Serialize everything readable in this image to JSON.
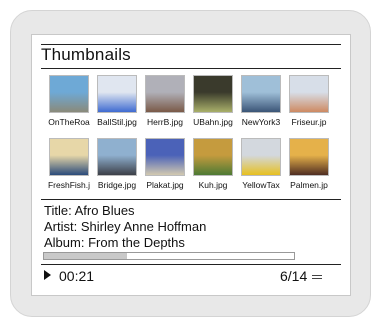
{
  "header": {
    "title": "Thumbnails"
  },
  "thumbnails": [
    {
      "label": "OnTheRoa",
      "icon": "road-photo",
      "color1": "#6ea9d6",
      "color2": "#8a8a7a"
    },
    {
      "label": "BallStil.jpg",
      "icon": "balls-photo",
      "color1": "#e0e6f0",
      "color2": "#3f6bd1"
    },
    {
      "label": "HerrB.jpg",
      "icon": "portrait-photo",
      "color1": "#b0b0b8",
      "color2": "#7a5a48"
    },
    {
      "label": "UBahn.jpg",
      "icon": "subway-photo",
      "color1": "#3a3a2c",
      "color2": "#a9b06a"
    },
    {
      "label": "NewYork3",
      "icon": "skyscraper-photo",
      "color1": "#9fbfd8",
      "color2": "#3b5577"
    },
    {
      "label": "Friseur.jp",
      "icon": "barber-photo",
      "color1": "#d7dee8",
      "color2": "#ce8a62"
    },
    {
      "label": "FreshFish.j",
      "icon": "fisherman-photo",
      "color1": "#e7d7a8",
      "color2": "#2a4a7a"
    },
    {
      "label": "Bridge.jpg",
      "icon": "bridge-photo",
      "color1": "#8fb0cf",
      "color2": "#3c3f47"
    },
    {
      "label": "Plakat.jpg",
      "icon": "poster-photo",
      "color1": "#4b62b8",
      "color2": "#d2c9b0"
    },
    {
      "label": "Kuh.jpg",
      "icon": "cow-photo",
      "color1": "#c59b3e",
      "color2": "#4d7a34"
    },
    {
      "label": "YellowTax",
      "icon": "taxi-photo",
      "color1": "#d3d8de",
      "color2": "#e6c020"
    },
    {
      "label": "Palmen.jp",
      "icon": "palms-photo",
      "color1": "#e5b14a",
      "color2": "#4f2d22"
    }
  ],
  "track": {
    "title_line": "Title: Afro Blues",
    "artist_line": "Artist: Shirley Anne Hoffman",
    "album_line": "Album: From the Depths",
    "progress": 0.33
  },
  "player": {
    "time": "00:21",
    "counter": "6/14"
  }
}
